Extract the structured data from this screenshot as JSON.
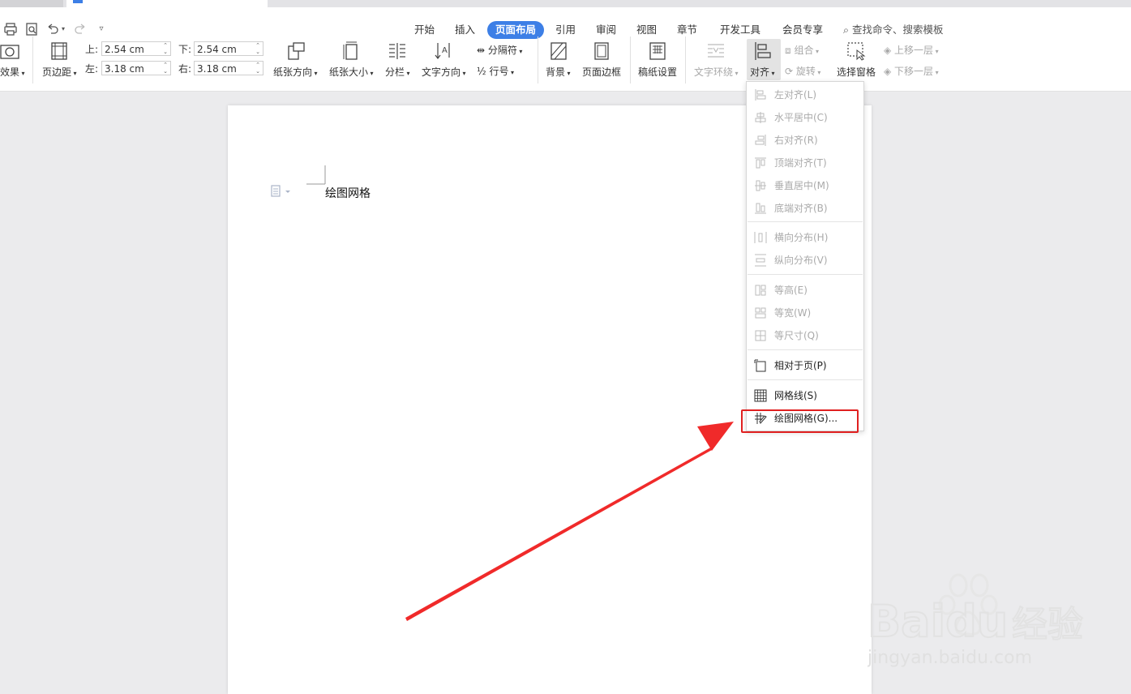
{
  "quick_access": {
    "icons": [
      "printer-icon",
      "print-preview-icon",
      "undo-icon",
      "redo-icon",
      "customize-icon"
    ]
  },
  "menu": {
    "tabs": [
      "开始",
      "插入",
      "页面布局",
      "引用",
      "审阅",
      "视图",
      "章节",
      "开发工具",
      "会员专享"
    ],
    "active": "页面布局",
    "search": "查找命令、搜索模板"
  },
  "ribbon": {
    "effects": "效果",
    "margins": "页边距",
    "margin_top_label": "上:",
    "margin_top": "2.54 cm",
    "margin_bottom_label": "下:",
    "margin_bottom": "2.54 cm",
    "margin_left_label": "左:",
    "margin_left": "3.18 cm",
    "margin_right_label": "右:",
    "margin_right": "3.18 cm",
    "orientation": "纸张方向",
    "size": "纸张大小",
    "columns": "分栏",
    "text_direction": "文字方向",
    "breaks": "分隔符",
    "line_numbers": "行号",
    "background": "背景",
    "page_border": "页面边框",
    "manuscript": "稿纸设置",
    "text_wrap": "文字环绕",
    "align": "对齐",
    "group": "组合",
    "rotate": "旋转",
    "selection_pane": "选择窗格",
    "bring_forward": "上移一层",
    "send_backward": "下移一层"
  },
  "document": {
    "text": "绘图网格"
  },
  "align_menu": {
    "items": [
      {
        "label": "左对齐(L)",
        "enabled": false
      },
      {
        "label": "水平居中(C)",
        "enabled": false
      },
      {
        "label": "右对齐(R)",
        "enabled": false
      },
      {
        "label": "顶端对齐(T)",
        "enabled": false
      },
      {
        "label": "垂直居中(M)",
        "enabled": false
      },
      {
        "label": "底端对齐(B)",
        "enabled": false
      },
      {
        "label": "横向分布(H)",
        "enabled": false
      },
      {
        "label": "纵向分布(V)",
        "enabled": false
      },
      {
        "label": "等高(E)",
        "enabled": false
      },
      {
        "label": "等宽(W)",
        "enabled": false
      },
      {
        "label": "等尺寸(Q)",
        "enabled": false
      },
      {
        "label": "相对于页(P)",
        "enabled": true
      },
      {
        "label": "网格线(S)",
        "enabled": true
      },
      {
        "label": "绘图网格(G)...",
        "enabled": true
      }
    ]
  },
  "annotation": {
    "highlight_color": "#e02020"
  },
  "watermark": {
    "brand": "Baidu",
    "suffix": "经验",
    "url": "jingyan.baidu.com"
  }
}
